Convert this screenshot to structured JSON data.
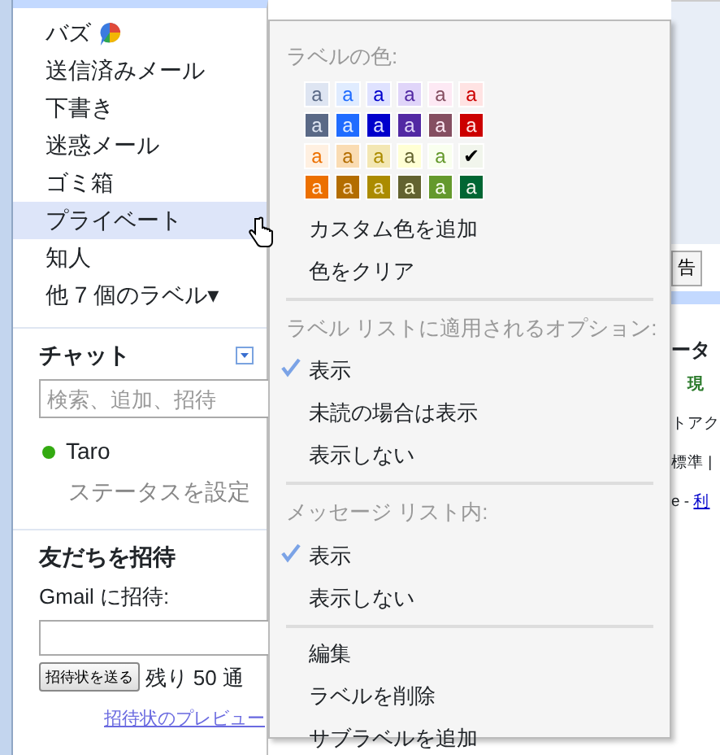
{
  "sidebar": {
    "labels": [
      {
        "label": "バズ",
        "icon": true,
        "selected": false
      },
      {
        "label": "送信済みメール",
        "selected": false
      },
      {
        "label": "下書き",
        "selected": false
      },
      {
        "label": "迷惑メール",
        "selected": false
      },
      {
        "label": "ゴミ箱",
        "selected": false
      },
      {
        "label": "プライベート",
        "selected": true
      },
      {
        "label": "知人",
        "selected": false
      },
      {
        "label": "他 7 個のラベル▾",
        "selected": false
      }
    ],
    "chat": {
      "title": "チャット",
      "search": {
        "placeholder": "検索、追加、招待"
      },
      "user": {
        "name": "Taro",
        "color": "#33aa11"
      },
      "status_link": "ステータスを設定"
    },
    "invite": {
      "title": "友だちを招待",
      "field_label": "Gmail に招待:",
      "button": "招待状を送る",
      "remaining": "残り 50 通",
      "preview_link": "招待状のプレビュー"
    }
  },
  "background": {
    "button": "告",
    "texts": [
      {
        "text": "ータ",
        "kind": "heading"
      },
      {
        "text": "現",
        "kind": "accent"
      },
      {
        "text": "トアク",
        "kind": "plain"
      },
      {
        "text": "標準 |",
        "kind": "plain"
      },
      {
        "text": "e - ",
        "kind": "plain",
        "link": "利"
      }
    ]
  },
  "menu": {
    "title": "ラベルの色:",
    "swatches": [
      [
        {
          "label": "a",
          "color": "#dee5f2",
          "selected": false
        },
        {
          "label": "a",
          "color": "#e0ecff",
          "selected": false
        },
        {
          "label": "a",
          "color": "#dfe2ff",
          "selected": false
        },
        {
          "label": "a",
          "color": "#e0d5f9",
          "selected": false
        },
        {
          "label": "a",
          "color": "#fde9f4",
          "selected": false
        },
        {
          "label": "a",
          "color": "#ffe3e3",
          "selected": false
        }
      ],
      [
        {
          "label": "a",
          "color": "#5a6986",
          "selected": false
        },
        {
          "label": "a",
          "color": "#206cff",
          "selected": false
        },
        {
          "label": "a",
          "color": "#0000cc",
          "selected": false
        },
        {
          "label": "a",
          "color": "#5229a3",
          "selected": false
        },
        {
          "label": "a",
          "color": "#854f61",
          "selected": false
        },
        {
          "label": "a",
          "color": "#cc0000",
          "selected": false
        }
      ],
      [
        {
          "label": "a",
          "color": "#fff0e1",
          "selected": false
        },
        {
          "label": "a",
          "color": "#fadcb3",
          "selected": false
        },
        {
          "label": "a",
          "color": "#f3e7b3",
          "selected": false
        },
        {
          "label": "a",
          "color": "#ffffd4",
          "selected": false
        },
        {
          "label": "a",
          "color": "#f9ffef",
          "selected": false
        },
        {
          "label": "✔",
          "color": "#f1f5ec",
          "selected": true
        }
      ],
      [
        {
          "label": "a",
          "color": "#ec7000",
          "selected": false
        },
        {
          "label": "a",
          "color": "#b36d00",
          "selected": false
        },
        {
          "label": "a",
          "color": "#ab8b00",
          "selected": false
        },
        {
          "label": "a",
          "color": "#636330",
          "selected": false
        },
        {
          "label": "a",
          "color": "#64992c",
          "selected": false
        },
        {
          "label": "a",
          "color": "#006633",
          "selected": false
        }
      ]
    ],
    "sections": [
      {
        "items": [
          {
            "label": "カスタム色を追加"
          },
          {
            "label": "色をクリア"
          }
        ]
      },
      {
        "header": "ラベル リストに適用されるオプション:",
        "items": [
          {
            "label": "表示",
            "checked": true
          },
          {
            "label": "未読の場合は表示",
            "checked": false
          },
          {
            "label": "表示しない",
            "checked": false
          }
        ]
      },
      {
        "header": "メッセージ リスト内:",
        "items": [
          {
            "label": "表示",
            "checked": true
          },
          {
            "label": "表示しない",
            "checked": false
          }
        ]
      },
      {
        "items": [
          {
            "label": "編集"
          },
          {
            "label": "ラベルを削除"
          },
          {
            "label": "サブラベルを追加"
          }
        ]
      }
    ]
  }
}
